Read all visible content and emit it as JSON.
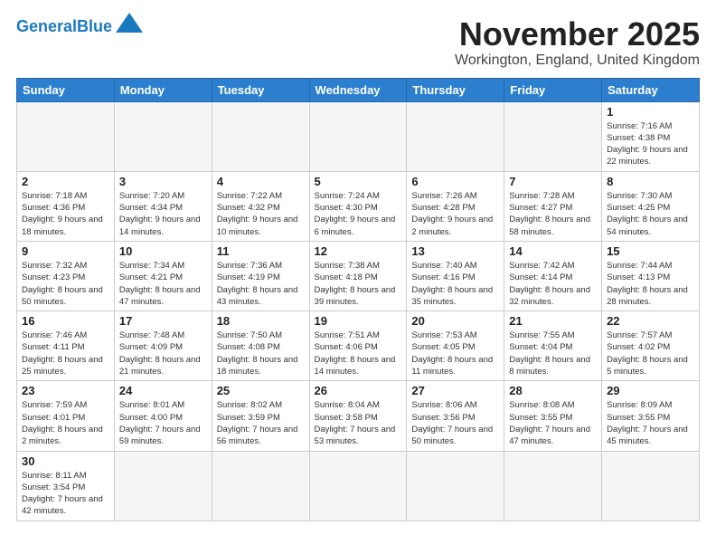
{
  "header": {
    "logo_general": "General",
    "logo_blue": "Blue",
    "month_title": "November 2025",
    "location": "Workington, England, United Kingdom"
  },
  "weekdays": [
    "Sunday",
    "Monday",
    "Tuesday",
    "Wednesday",
    "Thursday",
    "Friday",
    "Saturday"
  ],
  "weeks": [
    [
      {
        "day": "",
        "info": ""
      },
      {
        "day": "",
        "info": ""
      },
      {
        "day": "",
        "info": ""
      },
      {
        "day": "",
        "info": ""
      },
      {
        "day": "",
        "info": ""
      },
      {
        "day": "",
        "info": ""
      },
      {
        "day": "1",
        "info": "Sunrise: 7:16 AM\nSunset: 4:38 PM\nDaylight: 9 hours and 22 minutes."
      }
    ],
    [
      {
        "day": "2",
        "info": "Sunrise: 7:18 AM\nSunset: 4:36 PM\nDaylight: 9 hours and 18 minutes."
      },
      {
        "day": "3",
        "info": "Sunrise: 7:20 AM\nSunset: 4:34 PM\nDaylight: 9 hours and 14 minutes."
      },
      {
        "day": "4",
        "info": "Sunrise: 7:22 AM\nSunset: 4:32 PM\nDaylight: 9 hours and 10 minutes."
      },
      {
        "day": "5",
        "info": "Sunrise: 7:24 AM\nSunset: 4:30 PM\nDaylight: 9 hours and 6 minutes."
      },
      {
        "day": "6",
        "info": "Sunrise: 7:26 AM\nSunset: 4:28 PM\nDaylight: 9 hours and 2 minutes."
      },
      {
        "day": "7",
        "info": "Sunrise: 7:28 AM\nSunset: 4:27 PM\nDaylight: 8 hours and 58 minutes."
      },
      {
        "day": "8",
        "info": "Sunrise: 7:30 AM\nSunset: 4:25 PM\nDaylight: 8 hours and 54 minutes."
      }
    ],
    [
      {
        "day": "9",
        "info": "Sunrise: 7:32 AM\nSunset: 4:23 PM\nDaylight: 8 hours and 50 minutes."
      },
      {
        "day": "10",
        "info": "Sunrise: 7:34 AM\nSunset: 4:21 PM\nDaylight: 8 hours and 47 minutes."
      },
      {
        "day": "11",
        "info": "Sunrise: 7:36 AM\nSunset: 4:19 PM\nDaylight: 8 hours and 43 minutes."
      },
      {
        "day": "12",
        "info": "Sunrise: 7:38 AM\nSunset: 4:18 PM\nDaylight: 8 hours and 39 minutes."
      },
      {
        "day": "13",
        "info": "Sunrise: 7:40 AM\nSunset: 4:16 PM\nDaylight: 8 hours and 35 minutes."
      },
      {
        "day": "14",
        "info": "Sunrise: 7:42 AM\nSunset: 4:14 PM\nDaylight: 8 hours and 32 minutes."
      },
      {
        "day": "15",
        "info": "Sunrise: 7:44 AM\nSunset: 4:13 PM\nDaylight: 8 hours and 28 minutes."
      }
    ],
    [
      {
        "day": "16",
        "info": "Sunrise: 7:46 AM\nSunset: 4:11 PM\nDaylight: 8 hours and 25 minutes."
      },
      {
        "day": "17",
        "info": "Sunrise: 7:48 AM\nSunset: 4:09 PM\nDaylight: 8 hours and 21 minutes."
      },
      {
        "day": "18",
        "info": "Sunrise: 7:50 AM\nSunset: 4:08 PM\nDaylight: 8 hours and 18 minutes."
      },
      {
        "day": "19",
        "info": "Sunrise: 7:51 AM\nSunset: 4:06 PM\nDaylight: 8 hours and 14 minutes."
      },
      {
        "day": "20",
        "info": "Sunrise: 7:53 AM\nSunset: 4:05 PM\nDaylight: 8 hours and 11 minutes."
      },
      {
        "day": "21",
        "info": "Sunrise: 7:55 AM\nSunset: 4:04 PM\nDaylight: 8 hours and 8 minutes."
      },
      {
        "day": "22",
        "info": "Sunrise: 7:57 AM\nSunset: 4:02 PM\nDaylight: 8 hours and 5 minutes."
      }
    ],
    [
      {
        "day": "23",
        "info": "Sunrise: 7:59 AM\nSunset: 4:01 PM\nDaylight: 8 hours and 2 minutes."
      },
      {
        "day": "24",
        "info": "Sunrise: 8:01 AM\nSunset: 4:00 PM\nDaylight: 7 hours and 59 minutes."
      },
      {
        "day": "25",
        "info": "Sunrise: 8:02 AM\nSunset: 3:59 PM\nDaylight: 7 hours and 56 minutes."
      },
      {
        "day": "26",
        "info": "Sunrise: 8:04 AM\nSunset: 3:58 PM\nDaylight: 7 hours and 53 minutes."
      },
      {
        "day": "27",
        "info": "Sunrise: 8:06 AM\nSunset: 3:56 PM\nDaylight: 7 hours and 50 minutes."
      },
      {
        "day": "28",
        "info": "Sunrise: 8:08 AM\nSunset: 3:55 PM\nDaylight: 7 hours and 47 minutes."
      },
      {
        "day": "29",
        "info": "Sunrise: 8:09 AM\nSunset: 3:55 PM\nDaylight: 7 hours and 45 minutes."
      }
    ],
    [
      {
        "day": "30",
        "info": "Sunrise: 8:11 AM\nSunset: 3:54 PM\nDaylight: 7 hours and 42 minutes."
      },
      {
        "day": "",
        "info": ""
      },
      {
        "day": "",
        "info": ""
      },
      {
        "day": "",
        "info": ""
      },
      {
        "day": "",
        "info": ""
      },
      {
        "day": "",
        "info": ""
      },
      {
        "day": "",
        "info": ""
      }
    ]
  ]
}
